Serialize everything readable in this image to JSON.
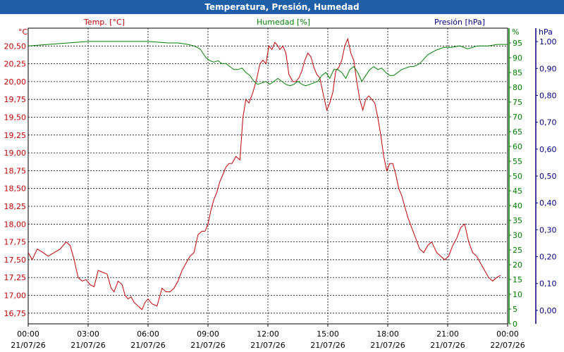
{
  "window": {
    "title": "Temperatura, Presión, Humedad"
  },
  "colors": {
    "temperature": "#c00000",
    "humidity": "#008000",
    "pressure": "#000080",
    "titlebar": "#1f5fa8"
  },
  "chart_data": {
    "type": "line",
    "axes": {
      "temperature": {
        "label": "Temp. [°C]",
        "unit": "°C",
        "ylim": [
          16.6,
          20.75
        ],
        "ticks": [
          "16,75",
          "17,00",
          "17,25",
          "17,50",
          "17,75",
          "18,00",
          "18,25",
          "18,50",
          "18,75",
          "19,00",
          "19,25",
          "19,50",
          "19,75",
          "20,00",
          "20,25",
          "20,50"
        ]
      },
      "humidity": {
        "label": "Humedad [%]",
        "unit": "%",
        "ylim": [
          0,
          100
        ],
        "ticks": [
          "0",
          "5",
          "10",
          "15",
          "20",
          "25",
          "30",
          "35",
          "40",
          "45",
          "50",
          "55",
          "60",
          "65",
          "70",
          "75",
          "80",
          "85",
          "90",
          "95"
        ]
      },
      "pressure": {
        "label": "Presión [hPa]",
        "unit": "hPa",
        "ylim": [
          -0.05,
          1.05
        ],
        "ticks": [
          "0,00",
          "0,10",
          "0,20",
          "0,30",
          "0,40",
          "0,50",
          "0,60",
          "0,70",
          "0,80",
          "0,90",
          "1,00"
        ]
      }
    },
    "x_ticks": [
      {
        "time": "00:00",
        "date": "21/07/26"
      },
      {
        "time": "03:00",
        "date": "21/07/26"
      },
      {
        "time": "06:00",
        "date": "21/07/26"
      },
      {
        "time": "09:00",
        "date": "21/07/26"
      },
      {
        "time": "12:00",
        "date": "21/07/26"
      },
      {
        "time": "15:00",
        "date": "21/07/26"
      },
      {
        "time": "18:00",
        "date": "21/07/26"
      },
      {
        "time": "21:00",
        "date": "21/07/26"
      },
      {
        "time": "00:00",
        "date": "22/07/26"
      }
    ],
    "grid": true,
    "series": [
      {
        "name": "Temp. [°C]",
        "axis": "temperature",
        "x_hours": [
          0,
          0.2,
          0.45,
          0.75,
          1.0,
          1.3,
          1.6,
          1.9,
          2.1,
          2.3,
          2.5,
          2.7,
          2.9,
          3.1,
          3.3,
          3.5,
          3.75,
          3.95,
          4.15,
          4.3,
          4.5,
          4.7,
          4.85,
          5.0,
          5.15,
          5.3,
          5.5,
          5.7,
          5.85,
          6.0,
          6.2,
          6.45,
          6.7,
          6.9,
          7.1,
          7.3,
          7.5,
          7.7,
          7.9,
          8.1,
          8.3,
          8.5,
          8.7,
          8.85,
          9.0,
          9.15,
          9.3,
          9.45,
          9.6,
          9.75,
          9.9,
          10.05,
          10.2,
          10.4,
          10.6,
          10.75,
          10.9,
          11.05,
          11.25,
          11.45,
          11.6,
          11.75,
          11.9,
          12.05,
          12.2,
          12.35,
          12.5,
          12.6,
          12.75,
          12.9,
          13.05,
          13.25,
          13.4,
          13.55,
          13.7,
          13.85,
          14.0,
          14.15,
          14.3,
          14.45,
          14.6,
          14.75,
          14.95,
          15.1,
          15.25,
          15.4,
          15.55,
          15.7,
          15.85,
          16.0,
          16.15,
          16.3,
          16.45,
          16.6,
          16.75,
          16.9,
          17.05,
          17.2,
          17.35,
          17.5,
          17.65,
          17.8,
          17.95,
          18.1,
          18.25,
          18.4,
          18.55,
          18.7,
          18.85,
          19.0,
          19.2,
          19.4,
          19.6,
          19.8,
          20.0,
          20.2,
          20.45,
          20.65,
          20.85,
          21.05,
          21.25,
          21.45,
          21.65,
          21.85,
          22.05,
          22.25,
          22.45,
          22.65,
          22.85,
          23.05,
          23.25,
          23.45,
          23.65,
          23.85,
          24.0
        ],
        "values": [
          17.6,
          17.5,
          17.65,
          17.6,
          17.55,
          17.6,
          17.65,
          17.75,
          17.7,
          17.5,
          17.25,
          17.2,
          17.22,
          17.15,
          17.12,
          17.35,
          17.32,
          17.3,
          17.1,
          17.05,
          17.2,
          17.15,
          17.0,
          16.95,
          16.98,
          16.9,
          16.85,
          16.8,
          16.9,
          16.95,
          16.88,
          16.85,
          17.1,
          17.05,
          17.05,
          17.1,
          17.2,
          17.35,
          17.45,
          17.55,
          17.6,
          17.85,
          17.9,
          17.9,
          18.0,
          18.2,
          18.35,
          18.45,
          18.6,
          18.7,
          18.8,
          18.85,
          18.85,
          18.95,
          18.9,
          19.5,
          19.75,
          19.7,
          19.85,
          20.05,
          20.25,
          20.3,
          20.25,
          20.5,
          20.45,
          20.55,
          20.5,
          20.45,
          20.5,
          20.4,
          20.1,
          20.0,
          20.0,
          20.05,
          20.15,
          20.3,
          20.4,
          20.35,
          20.2,
          20.1,
          20.05,
          19.85,
          19.6,
          19.7,
          19.85,
          20.15,
          20.2,
          20.3,
          20.5,
          20.6,
          20.4,
          20.3,
          20.0,
          19.75,
          19.6,
          19.75,
          19.8,
          19.75,
          19.7,
          19.5,
          19.25,
          18.95,
          18.75,
          18.85,
          18.85,
          18.7,
          18.5,
          18.4,
          18.25,
          18.1,
          17.95,
          17.8,
          17.65,
          17.6,
          17.7,
          17.75,
          17.6,
          17.55,
          17.5,
          17.55,
          17.7,
          17.8,
          17.95,
          18.0,
          17.75,
          17.6,
          17.55,
          17.45,
          17.35,
          17.25,
          17.2,
          17.25,
          17.28
        ]
      },
      {
        "name": "Humedad [%]",
        "axis": "humidity",
        "x_hours": [
          0,
          1,
          2,
          3,
          4,
          5,
          6,
          7,
          7.5,
          8,
          8.3,
          8.6,
          8.9,
          9.1,
          9.3,
          9.5,
          9.7,
          9.9,
          10.1,
          10.3,
          10.5,
          10.7,
          10.9,
          11.1,
          11.3,
          11.5,
          11.7,
          11.9,
          12.1,
          12.3,
          12.5,
          12.7,
          12.9,
          13.1,
          13.3,
          13.5,
          13.7,
          13.9,
          14.1,
          14.3,
          14.5,
          14.7,
          14.9,
          15.1,
          15.3,
          15.5,
          15.7,
          15.9,
          16.1,
          16.3,
          16.5,
          16.7,
          16.9,
          17.1,
          17.3,
          17.5,
          17.7,
          17.9,
          18.1,
          18.3,
          18.5,
          18.7,
          18.9,
          19.1,
          19.3,
          19.6,
          20.0,
          20.4,
          20.8,
          21.2,
          21.6,
          22.0,
          22.5,
          23.0,
          23.5,
          24.0
        ],
        "values": [
          94,
          94.5,
          95,
          95.5,
          95.5,
          95.5,
          95.5,
          95,
          95,
          94.5,
          94,
          93,
          90,
          89,
          88.5,
          89,
          88,
          88,
          87,
          86,
          86,
          86.5,
          85,
          84,
          82,
          81,
          81.5,
          82,
          81,
          82,
          83,
          82,
          81,
          80.5,
          81,
          82,
          81,
          80.5,
          81,
          81.5,
          82,
          84,
          85,
          83,
          86,
          86,
          85,
          83,
          86,
          87,
          85,
          82,
          84,
          86,
          87,
          86,
          86.5,
          85,
          84,
          84,
          85,
          86,
          86.5,
          87,
          87,
          88,
          91,
          92.5,
          93.5,
          93.5,
          94,
          93,
          94,
          94,
          94.5,
          94.5
        ]
      },
      {
        "name": "Presión [hPa]",
        "axis": "pressure",
        "x_hours": [],
        "values": []
      }
    ]
  }
}
